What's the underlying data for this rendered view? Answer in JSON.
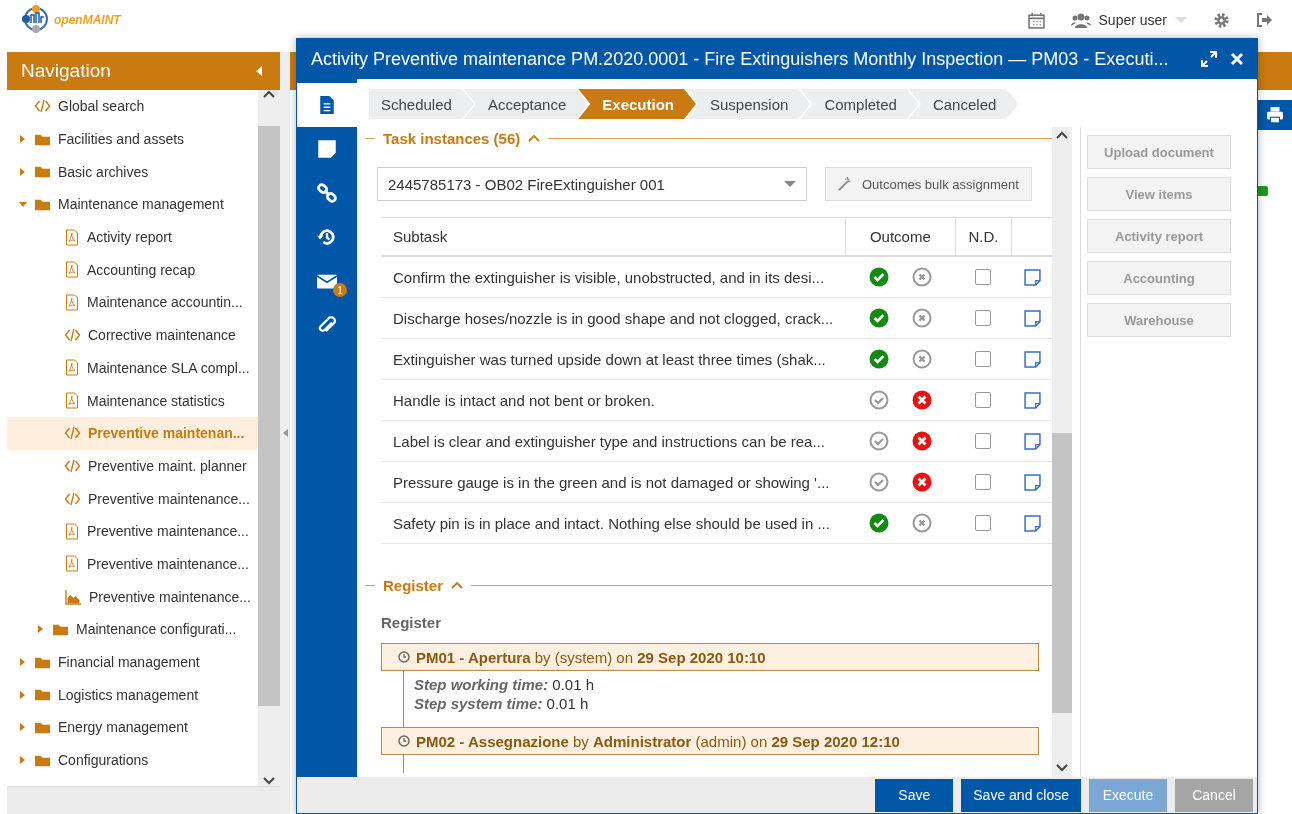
{
  "header": {
    "logo": "openMAINT",
    "user": "Super user"
  },
  "navigation": {
    "title": "Navigation",
    "items": [
      {
        "label": "Global search",
        "kind": "custom",
        "selected": false
      },
      {
        "label": "Facilities and assets",
        "kind": "folder",
        "expanded": false,
        "selected": false
      },
      {
        "label": "Basic archives",
        "kind": "folder",
        "expanded": false,
        "selected": false
      },
      {
        "label": "Maintenance management",
        "kind": "folder",
        "expanded": true,
        "selected": false,
        "children": [
          {
            "label": "Activity report",
            "kind": "report",
            "selected": false
          },
          {
            "label": "Accounting recap",
            "kind": "report",
            "selected": false
          },
          {
            "label": "Maintenance accountin...",
            "kind": "report",
            "selected": false
          },
          {
            "label": "Corrective maintenance",
            "kind": "custom",
            "selected": false
          },
          {
            "label": "Maintenance SLA compl...",
            "kind": "report",
            "selected": false
          },
          {
            "label": "Maintenance statistics",
            "kind": "report",
            "selected": false
          },
          {
            "label": "Preventive maintenan...",
            "kind": "custom",
            "selected": true
          },
          {
            "label": "Preventive maint. planner",
            "kind": "custom",
            "selected": false
          },
          {
            "label": "Preventive maintenance...",
            "kind": "custom",
            "selected": false
          },
          {
            "label": "Preventive maintenance...",
            "kind": "report",
            "selected": false
          },
          {
            "label": "Preventive maintenance...",
            "kind": "report",
            "selected": false
          },
          {
            "label": "Preventive maintenance...",
            "kind": "chart",
            "selected": false
          },
          {
            "label": "Maintenance configurati...",
            "kind": "folder",
            "expanded": false,
            "selected": false
          }
        ]
      },
      {
        "label": "Financial management",
        "kind": "folder",
        "expanded": false,
        "selected": false
      },
      {
        "label": "Logistics management",
        "kind": "folder",
        "expanded": false,
        "selected": false
      },
      {
        "label": "Energy management",
        "kind": "folder",
        "expanded": false,
        "selected": false
      },
      {
        "label": "Configurations",
        "kind": "folder",
        "expanded": false,
        "selected": false
      }
    ]
  },
  "dialog": {
    "title": "Activity Preventive maintenance PM.2020.0001 - Fire Extinguishers Monthly Inspection — PM03 - Executi...",
    "tabs": [
      {
        "kind": "form",
        "selected": true
      },
      {
        "kind": "notes",
        "selected": false
      },
      {
        "kind": "relations",
        "selected": false
      },
      {
        "kind": "history",
        "selected": false
      },
      {
        "kind": "email",
        "selected": false,
        "badge": "1"
      },
      {
        "kind": "attachments",
        "selected": false
      }
    ],
    "steps": [
      {
        "label": "Scheduled",
        "selected": false
      },
      {
        "label": "Acceptance",
        "selected": false
      },
      {
        "label": "Execution",
        "selected": true
      },
      {
        "label": "Suspension",
        "selected": false
      },
      {
        "label": "Completed",
        "selected": false
      },
      {
        "label": "Canceled",
        "selected": false
      }
    ],
    "task_section": {
      "title": "Task instances (56)",
      "expanded": true,
      "instance_select": {
        "value": "2445785173 - OB02 FireExtinguisher 001"
      },
      "bulk_button": "Outcomes bulk assignment",
      "columns": [
        "Subtask",
        "Outcome",
        "N.D."
      ],
      "rows": [
        {
          "subtask": "Confirm the extinguisher is visible, unobstructed, and in its desi...",
          "passed": true,
          "nd": false
        },
        {
          "subtask": "Discharge hoses/nozzle is in good shape and not clogged, crack...",
          "passed": true,
          "nd": false
        },
        {
          "subtask": "Extinguisher was turned upside down at least three times (shak...",
          "passed": true,
          "nd": false
        },
        {
          "subtask": "Handle is intact and not bent or broken.",
          "passed": false,
          "nd": false
        },
        {
          "subtask": "Label is clear and extinguisher type and instructions can be rea...",
          "passed": false,
          "nd": false
        },
        {
          "subtask": "Pressure gauge is in the green and is not damaged or showing '...",
          "passed": false,
          "nd": false
        },
        {
          "subtask": "Safety pin is in place and intact. Nothing else should be used in ...",
          "passed": true,
          "nd": false
        }
      ]
    },
    "register_section": {
      "title": "Register",
      "expanded": true,
      "label": "Register",
      "entries": [
        {
          "header": "**PM01 - Apertura** by (system) on **29 Sep 2020 10:10**",
          "details": [
            {
              "label": "Step working time:",
              "value": "0.01 h"
            },
            {
              "label": "Step system time:",
              "value": "0.01 h"
            }
          ]
        },
        {
          "header": "**PM02 - Assegnazione** by **Administrator** (admin) on **29 Sep 2020 12:10**"
        }
      ]
    },
    "side_buttons": [
      {
        "label": "Upload document",
        "disabled": true
      },
      {
        "label": "View items",
        "disabled": true
      },
      {
        "label": "Activity report",
        "disabled": true
      },
      {
        "label": "Accounting",
        "disabled": true
      },
      {
        "label": "Warehouse",
        "disabled": true
      }
    ],
    "footer_buttons": [
      {
        "label": "Save",
        "kind": "primary"
      },
      {
        "label": "Save and close",
        "kind": "primary"
      },
      {
        "label": "Execute",
        "kind": "disabled"
      },
      {
        "label": "Cancel",
        "kind": "secondary"
      }
    ]
  }
}
